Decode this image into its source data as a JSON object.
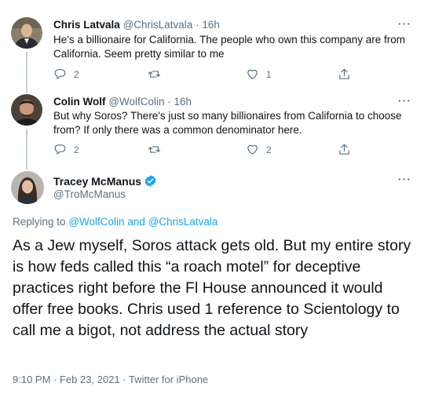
{
  "replies": [
    {
      "name": "Chris Latvala",
      "handle": "@ChrisLatvala",
      "time": "· 16h",
      "text": "He's a billionaire for California. The people who own this company are from California. Seem pretty similar to me",
      "reply_count": "2",
      "retweet_count": "",
      "like_count": "1"
    },
    {
      "name": "Colin Wolf",
      "handle": "@WolfColin",
      "time": "· 16h",
      "text": "But why Soros? There's just so many billionaires from California to choose from? If only there was a common denominator here.",
      "reply_count": "2",
      "retweet_count": "",
      "like_count": "2"
    }
  ],
  "main_tweet": {
    "name": "Tracey McManus",
    "handle": "@TroMcManus",
    "verified": true,
    "replying_prefix": "Replying to",
    "replying_user1": "@WolfColin",
    "replying_and": "and",
    "replying_user2": "@ChrisLatvala",
    "text": "As a Jew myself, Soros attack gets old. But my entire story is how feds called this “a roach motel” for deceptive practices right before the Fl House announced it would offer free books. Chris used 1 reference to Scientology to call me a bigot, not address the actual story",
    "time": "9:10 PM",
    "dot": "·",
    "date": "Feb 23, 2021",
    "source": "Twitter for iPhone"
  },
  "more_label": "···",
  "colors": {
    "accent": "#1da1f2",
    "secondary_text": "#5b7083",
    "primary_text": "#0f1419",
    "thread_line": "#c4cfd6"
  },
  "icons": [
    "reply-icon",
    "retweet-icon",
    "like-icon",
    "share-icon",
    "verified-badge-icon",
    "more-icon"
  ]
}
